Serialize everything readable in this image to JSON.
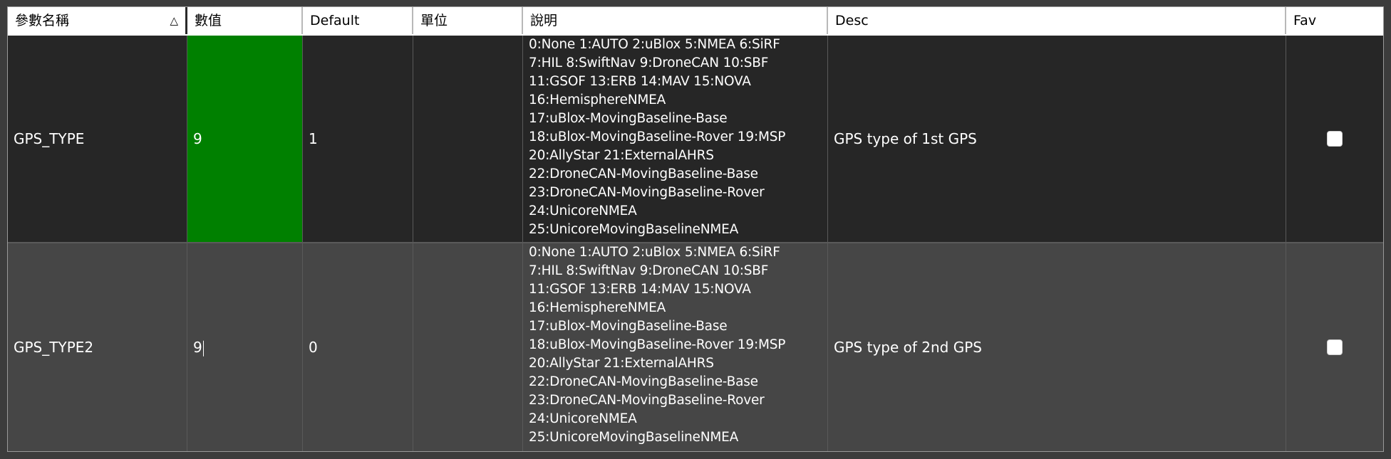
{
  "columns": {
    "name": "參數名稱",
    "value": "數值",
    "default": "Default",
    "units": "單位",
    "options": "說明",
    "desc": "Desc",
    "fav": "Fav"
  },
  "sort_indicator": "△",
  "rows": [
    {
      "name": "GPS_TYPE",
      "value": "9",
      "default": "1",
      "units": "",
      "options": "0:None 1:AUTO 2:uBlox 5:NMEA 6:SiRF\n7:HIL 8:SwiftNav 9:DroneCAN 10:SBF\n11:GSOF 13:ERB 14:MAV 15:NOVA\n16:HemisphereNMEA\n17:uBlox-MovingBaseline-Base\n18:uBlox-MovingBaseline-Rover 19:MSP\n20:AllyStar 21:ExternalAHRS\n22:DroneCAN-MovingBaseline-Base\n23:DroneCAN-MovingBaseline-Rover\n24:UnicoreNMEA\n25:UnicoreMovingBaselineNMEA",
      "desc": "GPS type of 1st GPS",
      "fav": false,
      "value_highlight": "#008000"
    },
    {
      "name": "GPS_TYPE2",
      "value": "9",
      "default": "0",
      "units": "",
      "options": "0:None 1:AUTO 2:uBlox 5:NMEA 6:SiRF\n7:HIL 8:SwiftNav 9:DroneCAN 10:SBF\n11:GSOF 13:ERB 14:MAV 15:NOVA\n16:HemisphereNMEA\n17:uBlox-MovingBaseline-Base\n18:uBlox-MovingBaseline-Rover 19:MSP\n20:AllyStar 21:ExternalAHRS\n22:DroneCAN-MovingBaseline-Base\n23:DroneCAN-MovingBaseline-Rover\n24:UnicoreNMEA\n25:UnicoreMovingBaselineNMEA",
      "desc": "GPS type of 2nd GPS",
      "fav": false
    }
  ]
}
